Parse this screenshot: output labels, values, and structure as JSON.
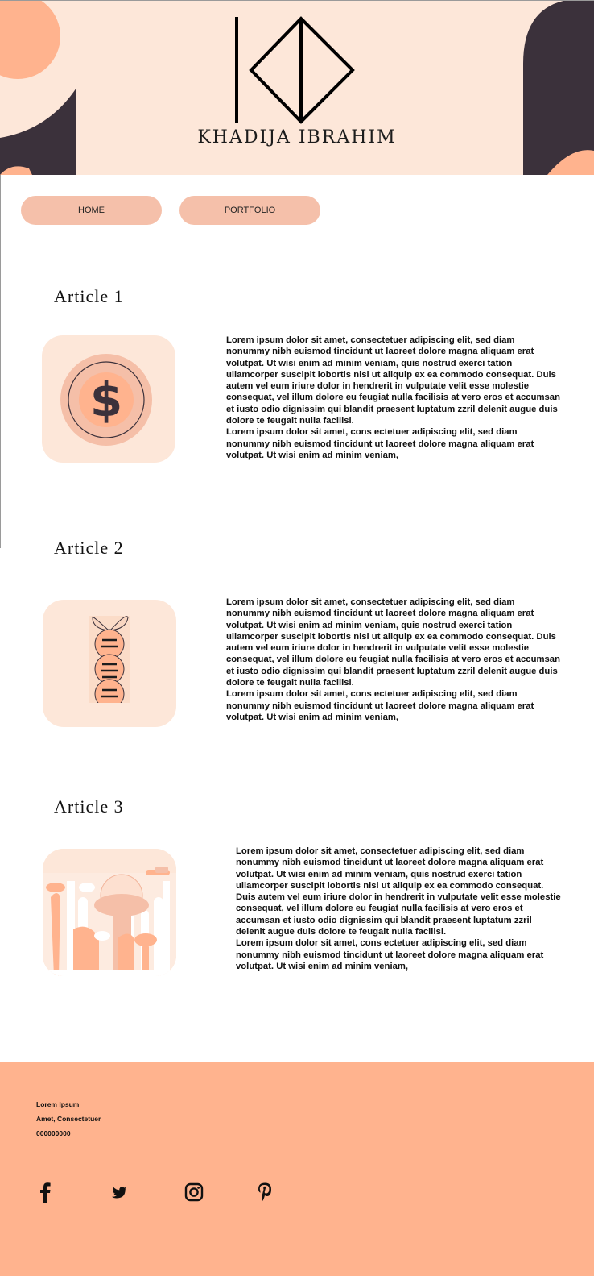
{
  "header": {
    "site_name": "KHADIJA IBRAHIM"
  },
  "nav": {
    "items": [
      {
        "label": "HOME"
      },
      {
        "label": "PORTFOLIO"
      }
    ]
  },
  "articles": [
    {
      "title": "Article 1",
      "icon": "dollar-coin-icon",
      "paragraph1": "Lorem ipsum dolor sit amet, consectetuer adipiscing elit, sed diam nonummy nibh euismod tincidunt ut laoreet dolore magna aliquam erat volutpat. Ut wisi enim ad minim veniam, quis nostrud exerci tation ullamcorper suscipit lobortis nisl ut aliquip ex ea commodo consequat. Duis autem vel eum iriure dolor in hendrerit in vulputate velit esse molestie consequat, vel illum dolore eu feugiat nulla facilisis at vero eros et accumsan et iusto odio dignissim qui blandit praesent luptatum zzril delenit augue duis dolore te feugait nulla facilisi.",
      "paragraph2": "Lorem ipsum dolor sit amet, cons ectetuer adipiscing elit, sed diam nonummy nibh euismod tincidunt ut laoreet dolore magna aliquam erat volutpat. Ut wisi enim ad minim veniam,"
    },
    {
      "title": "Article 2",
      "icon": "dna-sprout-icon",
      "paragraph1": "Lorem ipsum dolor sit amet, consectetuer adipiscing elit, sed diam nonummy nibh euismod tincidunt ut laoreet dolore magna aliquam erat volutpat. Ut wisi enim ad minim veniam, quis nostrud exerci tation ullamcorper suscipit lobortis nisl ut aliquip ex ea commodo consequat. Duis autem vel eum iriure dolor in hendrerit in vulputate velit esse molestie consequat, vel illum dolore eu feugiat nulla facilisis at vero eros et accumsan et iusto odio dignissim qui blandit praesent luptatum zzril delenit augue duis dolore te feugait nulla facilisi.",
      "paragraph2": "Lorem ipsum dolor sit amet, cons ectetuer adipiscing elit, sed diam nonummy nibh euismod tincidunt ut laoreet dolore magna aliquam erat volutpat. Ut wisi enim ad minim veniam,"
    },
    {
      "title": "Article 3",
      "icon": "laboratory-glassware-icon",
      "paragraph1": "Lorem ipsum dolor sit amet, consectetuer adipiscing elit, sed diam nonummy nibh euismod tincidunt ut laoreet dolore magna aliquam erat volutpat. Ut wisi enim ad minim veniam, quis nostrud exerci tation ullamcorper suscipit lobortis nisl ut aliquip ex ea commodo consequat. Duis autem vel eum iriure dolor in hendrerit in vulputate velit esse molestie consequat, vel illum dolore eu feugiat nulla facilisis at vero eros et accumsan et iusto odio dignissim qui blandit praesent luptatum zzril delenit augue duis dolore te feugait nulla facilisi.",
      "paragraph2": "Lorem ipsum dolor sit amet, cons ectetuer adipiscing elit, sed diam nonummy nibh euismod tincidunt ut laoreet dolore magna aliquam erat volutpat. Ut wisi enim ad minim veniam,"
    }
  ],
  "footer": {
    "line1": "Lorem Ipsum",
    "line2": "Amet, Consectetuer",
    "line3": "000000000",
    "social": [
      "facebook-icon",
      "twitter-icon",
      "instagram-icon",
      "pinterest-icon"
    ]
  },
  "colors": {
    "header_bg": "#fde7d9",
    "peach": "#ffb38e",
    "button": "#f5c0aa",
    "dark_plum": "#3b313b",
    "thumb_bg": "#fde7d9"
  }
}
